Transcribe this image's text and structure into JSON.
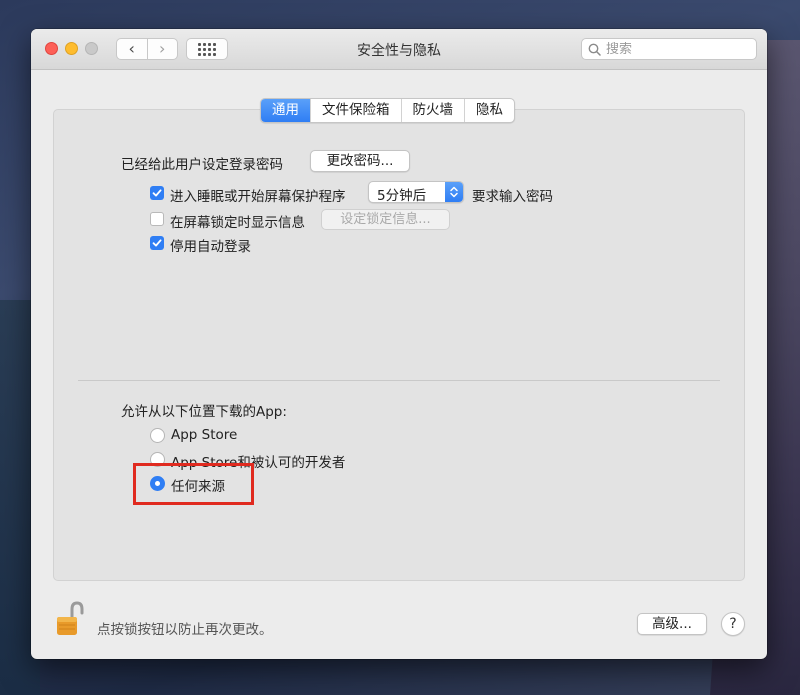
{
  "window": {
    "title": "安全性与隐私",
    "nav_back": "‹",
    "nav_forward": "›",
    "search_placeholder": "搜索"
  },
  "tabs": [
    {
      "label": "通用",
      "active": true
    },
    {
      "label": "文件保险箱",
      "active": false
    },
    {
      "label": "防火墙",
      "active": false
    },
    {
      "label": "隐私",
      "active": false
    }
  ],
  "general": {
    "password_label": "已经给此用户设定登录密码",
    "change_password_button": "更改密码...",
    "require_password": {
      "checked": true,
      "label": "进入睡眠或开始屏幕保护程序",
      "delay_value": "5分钟后",
      "suffix": "要求输入密码"
    },
    "show_message": {
      "checked": false,
      "label": "在屏幕锁定时显示信息",
      "button": "设定锁定信息..."
    },
    "disable_autologin": {
      "checked": true,
      "label": "停用自动登录"
    }
  },
  "downloads": {
    "heading": "允许从以下位置下载的App:",
    "options": [
      {
        "label": "App Store",
        "selected": false
      },
      {
        "label": "App Store和被认可的开发者",
        "selected": false
      },
      {
        "label": "任何来源",
        "selected": true
      }
    ]
  },
  "footer": {
    "lock_text": "点按锁按钮以防止再次更改。",
    "advanced_button": "高级...",
    "help_button": "?"
  },
  "colors": {
    "accent": "#2f7ef4",
    "highlight": "#e02a1f"
  }
}
